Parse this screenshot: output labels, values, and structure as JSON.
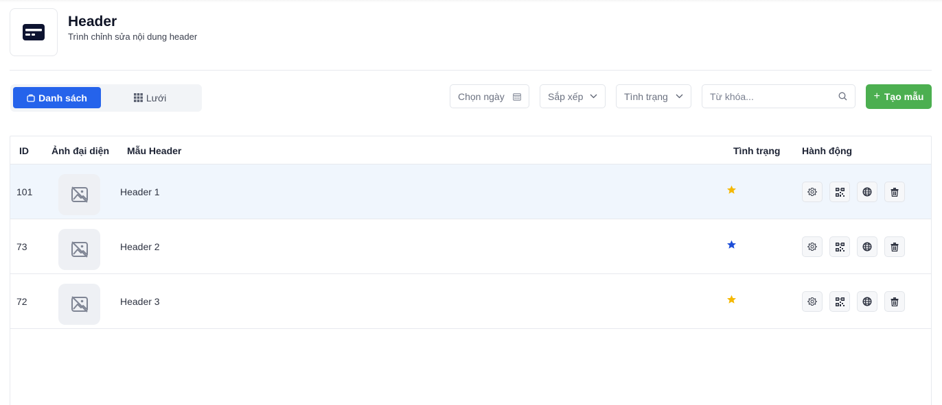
{
  "header": {
    "title": "Header",
    "subtitle": "Trình chỉnh sửa nội dung header",
    "icon": "header-card-icon"
  },
  "view_toggle": {
    "list_label": "Danh sách",
    "grid_label": "Lưới",
    "active": "list"
  },
  "filters": {
    "date_placeholder": "Chọn ngày",
    "sort_label": "Sắp xếp",
    "status_label": "Tình trạng",
    "search_placeholder": "Từ khóa..."
  },
  "create_button": {
    "label": "Tạo mẫu"
  },
  "table": {
    "columns": {
      "id": "ID",
      "thumbnail": "Ảnh đại diện",
      "name": "Mẫu Header",
      "status": "Tình trạng",
      "actions": "Hành động"
    },
    "rows": [
      {
        "id": "101",
        "name": "Header 1",
        "status_icon": "star-icon",
        "status_color": "#f5b800"
      },
      {
        "id": "73",
        "name": "Header 2",
        "status_icon": "star-icon",
        "status_color": "#1d4ed8"
      },
      {
        "id": "72",
        "name": "Header 3",
        "status_icon": "star-icon",
        "status_color": "#f5b800"
      }
    ],
    "action_icons": [
      "settings-icon",
      "qr-code-icon",
      "globe-icon",
      "trash-icon"
    ]
  },
  "colors": {
    "primary": "#2563eb",
    "success": "#4caf50",
    "selected_row": "#f0f6fd"
  }
}
